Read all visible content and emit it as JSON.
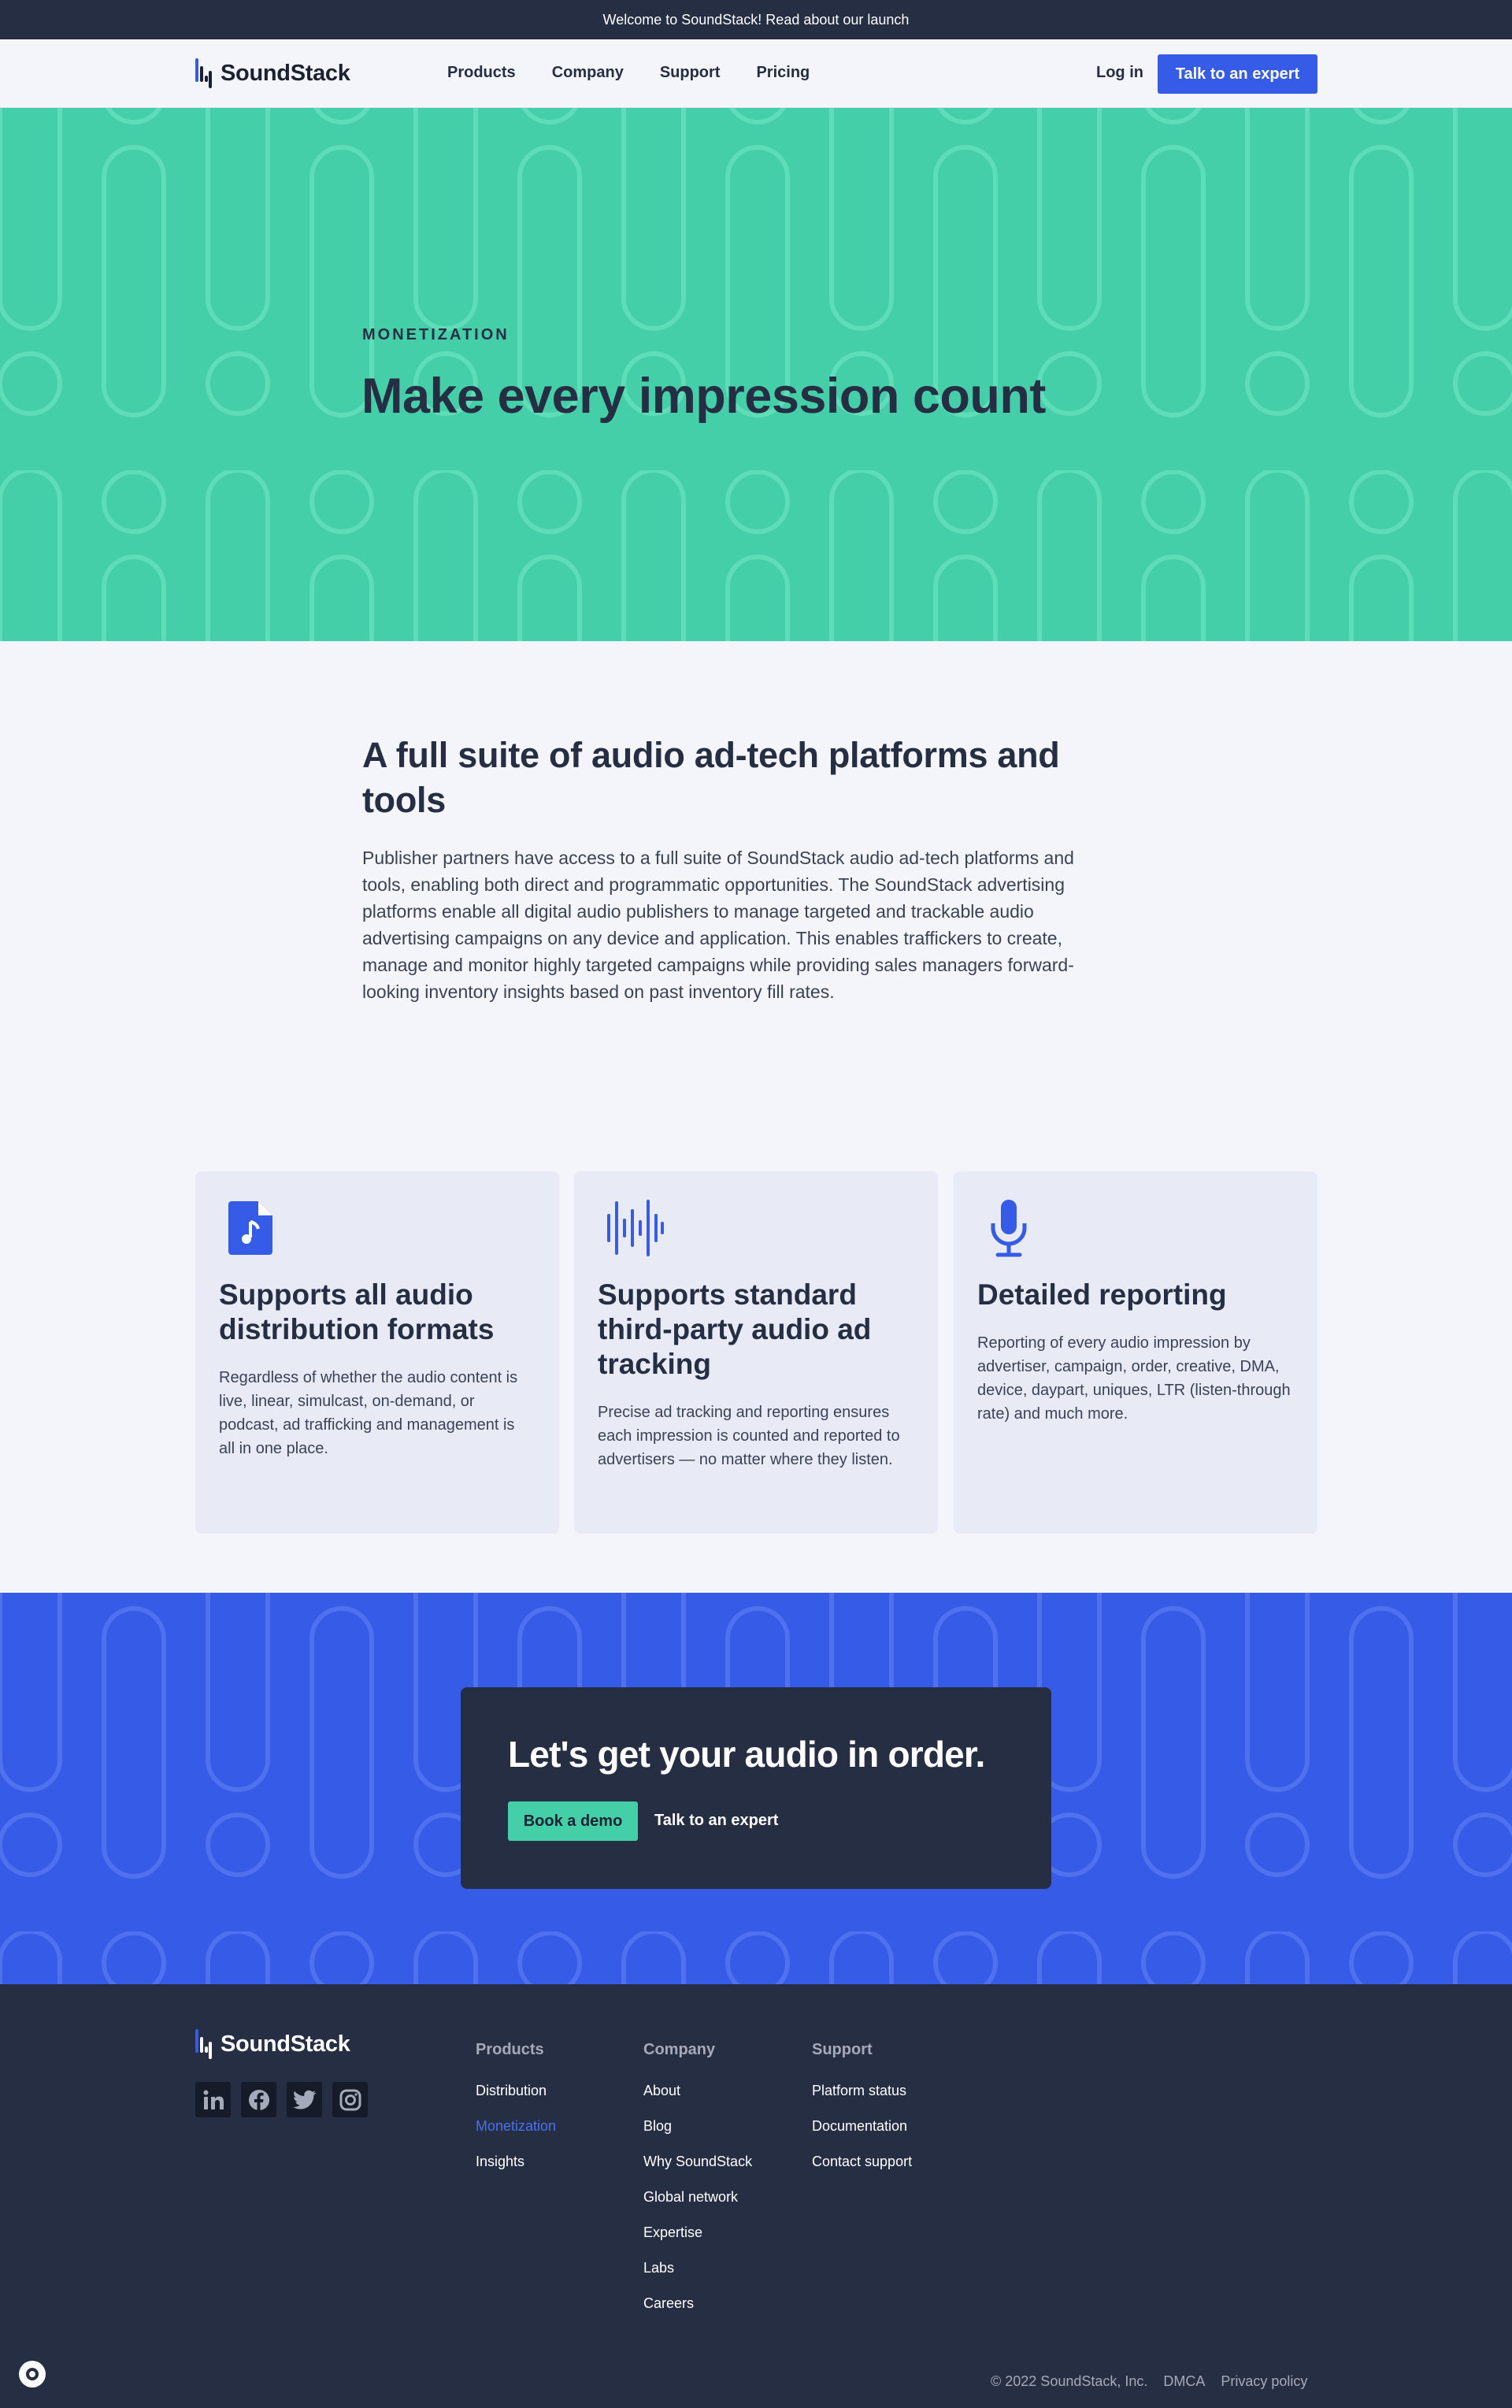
{
  "announcement": {
    "text": "Welcome to SoundStack! Read about our launch"
  },
  "brand": {
    "name": "SoundStack"
  },
  "nav": {
    "links": [
      "Products",
      "Company",
      "Support",
      "Pricing"
    ],
    "login": "Log in",
    "cta": "Talk to an expert"
  },
  "hero": {
    "eyebrow": "MONETIZATION",
    "title": "Make every impression count"
  },
  "intro": {
    "title": "A full suite of audio ad-tech platforms and tools",
    "text": "Publisher partners have access to a full suite of SoundStack audio ad-tech platforms and tools, enabling both direct and programmatic opportunities. The SoundStack advertising platforms enable all digital audio publishers to manage targeted and trackable audio advertising campaigns on any device and application. This enables traffickers to create, manage and monitor highly targeted campaigns while providing sales managers forward-looking inventory insights based on past inventory fill rates."
  },
  "features": [
    {
      "icon": "audio-file-icon",
      "title": "Supports all audio distribution formats",
      "text": "Regardless of whether the audio content is live, linear, simulcast, on-demand, or podcast, ad trafficking and management is all in one place."
    },
    {
      "icon": "audio-waveform-icon",
      "title": "Supports standard third-party audio ad tracking",
      "text": "Precise ad tracking and reporting ensures each impression is counted and reported to advertisers — no matter where they listen."
    },
    {
      "icon": "microphone-icon",
      "title": "Detailed reporting",
      "text": "Reporting of every audio impression by advertiser, campaign, order, creative, DMA, device, daypart, uniques, LTR (listen-through rate) and much more."
    }
  ],
  "cta": {
    "title": "Let's get your audio in order.",
    "demo": "Book a demo",
    "expert": "Talk to an expert"
  },
  "footer": {
    "socials": [
      "linkedin-icon",
      "facebook-icon",
      "twitter-icon",
      "instagram-icon"
    ],
    "products": {
      "heading": "Products",
      "items": [
        "Distribution",
        "Monetization",
        "Insights"
      ]
    },
    "company": {
      "heading": "Company",
      "items": [
        "About",
        "Blog",
        "Why SoundStack",
        "Global network",
        "Expertise",
        "Labs",
        "Careers"
      ]
    },
    "support": {
      "heading": "Support",
      "items": [
        "Platform status",
        "Documentation",
        "Contact support"
      ]
    },
    "copyright": "© 2022 SoundStack, Inc.",
    "dmca": "DMCA",
    "privacy": "Privacy policy"
  },
  "colors": {
    "navy": "#262e43",
    "teal": "#44cfa8",
    "blue": "#355be7",
    "page": "#f4f5fa",
    "card": "#e8eaf6"
  }
}
